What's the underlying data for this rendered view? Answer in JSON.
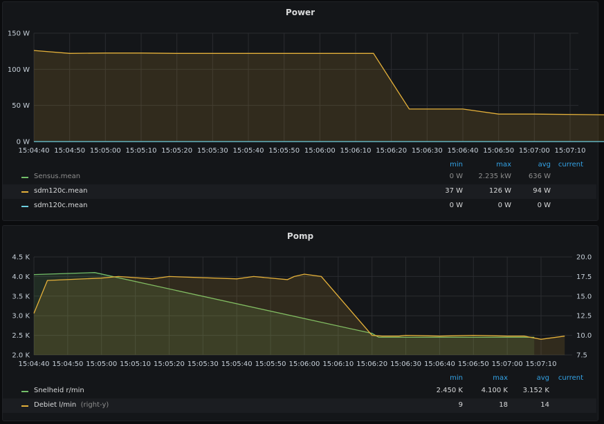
{
  "colors": {
    "yellow": "#e5b13a",
    "cyan": "#6fcfe0",
    "green": "#73bf69",
    "grid": "#2a2c30",
    "accent": "#33a2e5"
  },
  "legend_headers": {
    "min": "min",
    "max": "max",
    "avg": "avg",
    "current": "current"
  },
  "chart_data": [
    {
      "type": "area",
      "title": "Power",
      "x_ticks": [
        "15:04:40",
        "15:04:50",
        "15:05:00",
        "15:05:10",
        "15:05:20",
        "15:05:30",
        "15:05:40",
        "15:05:50",
        "15:06:00",
        "15:06:10",
        "15:06:20",
        "15:06:30",
        "15:06:40",
        "15:06:50",
        "15:07:00",
        "15:07:10"
      ],
      "y_ticks": [
        "0 W",
        "50 W",
        "100 W",
        "150 W"
      ],
      "ylim": [
        0,
        150
      ],
      "xlim": [
        "15:04:40",
        "15:07:10"
      ],
      "series": [
        {
          "name": "Sensus.mean",
          "color": "#73bf69",
          "points": [],
          "legend": {
            "min": "0 W",
            "max": "2.235 kW",
            "avg": "636 W",
            "current": ""
          }
        },
        {
          "name": "sdm120c.mean",
          "color": "#e5b13a",
          "fill": true,
          "points": [
            [
              "15:04:40",
              126
            ],
            [
              "15:04:50",
              122
            ],
            [
              "15:05:00",
              122.5
            ],
            [
              "15:05:10",
              122.5
            ],
            [
              "15:05:20",
              122
            ],
            [
              "15:05:30",
              122
            ],
            [
              "15:05:40",
              122
            ],
            [
              "15:05:50",
              122
            ],
            [
              "15:06:00",
              122
            ],
            [
              "15:06:10",
              122
            ],
            [
              "15:06:15",
              122
            ],
            [
              "15:06:25",
              45
            ],
            [
              "15:06:40",
              45
            ],
            [
              "15:06:50",
              38
            ],
            [
              "15:07:00",
              38
            ],
            [
              "15:07:20",
              37
            ]
          ],
          "legend": {
            "min": "37 W",
            "max": "126 W",
            "avg": "94 W",
            "current": ""
          }
        },
        {
          "name": "sdm120c.mean",
          "color": "#6fcfe0",
          "points": [
            [
              "15:04:40",
              0
            ],
            [
              "15:07:20",
              0
            ]
          ],
          "legend": {
            "min": "0 W",
            "max": "0 W",
            "avg": "0 W",
            "current": ""
          }
        }
      ]
    },
    {
      "type": "area",
      "title": "Pomp",
      "x_ticks": [
        "15:04:40",
        "15:04:50",
        "15:05:00",
        "15:05:10",
        "15:05:20",
        "15:05:30",
        "15:05:40",
        "15:05:50",
        "15:06:00",
        "15:06:10",
        "15:06:20",
        "15:06:30",
        "15:06:40",
        "15:06:50",
        "15:07:00",
        "15:07:10"
      ],
      "y_ticks": [
        "2.0 K",
        "2.5 K",
        "3.0 K",
        "3.5 K",
        "4.0 K",
        "4.5 K"
      ],
      "y2_ticks": [
        "7.5",
        "10.0",
        "12.5",
        "15.0",
        "17.5",
        "20.0"
      ],
      "ylim": [
        2000,
        4500
      ],
      "y2lim": [
        7.5,
        20
      ],
      "xlim": [
        "15:04:40",
        "15:07:10"
      ],
      "series": [
        {
          "name": "Snelheid r/min",
          "color": "#73bf69",
          "fill": true,
          "axis": "left",
          "points": [
            [
              "15:04:40",
              4050
            ],
            [
              "15:04:58",
              4100
            ],
            [
              "15:06:20",
              2550
            ],
            [
              "15:06:22",
              2450
            ],
            [
              "15:07:08",
              2450
            ]
          ],
          "legend": {
            "min": "2.450 K",
            "max": "4.100 K",
            "avg": "3.152 K",
            "current": ""
          }
        },
        {
          "name": "Debiet l/min",
          "tag": "(right-y)",
          "color": "#e5b13a",
          "fill": true,
          "axis": "right",
          "points": [
            [
              "15:04:40",
              12.8
            ],
            [
              "15:04:44",
              17.0
            ],
            [
              "15:05:00",
              17.3
            ],
            [
              "15:05:05",
              17.5
            ],
            [
              "15:05:15",
              17.2
            ],
            [
              "15:05:20",
              17.5
            ],
            [
              "15:05:40",
              17.2
            ],
            [
              "15:05:45",
              17.5
            ],
            [
              "15:05:55",
              17.1
            ],
            [
              "15:05:57",
              17.5
            ],
            [
              "15:06:00",
              17.8
            ],
            [
              "15:06:05",
              17.5
            ],
            [
              "15:06:20",
              10.0
            ],
            [
              "15:06:23",
              9.9
            ],
            [
              "15:06:28",
              9.9
            ],
            [
              "15:06:30",
              10.0
            ],
            [
              "15:06:40",
              9.9
            ],
            [
              "15:06:50",
              10.0
            ],
            [
              "15:07:00",
              9.9
            ],
            [
              "15:07:05",
              9.9
            ],
            [
              "15:07:10",
              9.5
            ],
            [
              "15:07:17",
              9.9
            ]
          ],
          "legend": {
            "min": "9",
            "max": "18",
            "avg": "14",
            "current": ""
          }
        }
      ]
    }
  ]
}
